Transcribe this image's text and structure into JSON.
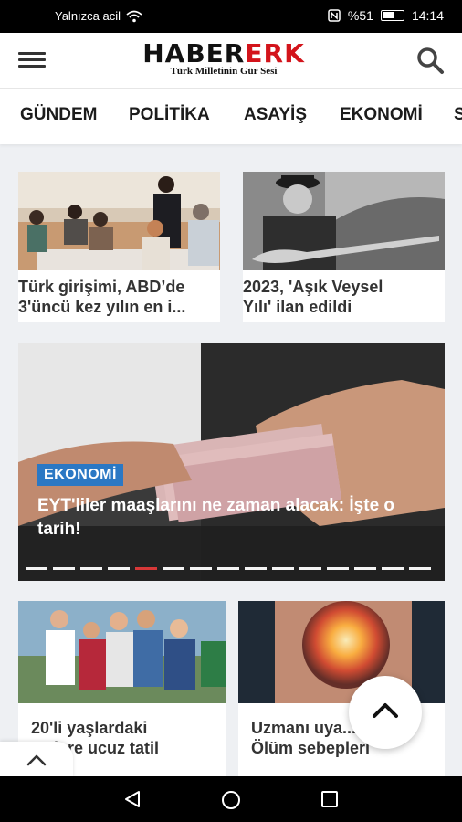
{
  "status": {
    "carrier": "Yalnızca acil",
    "battery": "%51",
    "time": "14:14"
  },
  "header": {
    "logo_part1": "HABER",
    "logo_part2": "ERK",
    "slogan": "Türk Milletinin Gür Sesi",
    "brand_colors": {
      "dark": "#111111",
      "red": "#d3141b"
    }
  },
  "categories": [
    "GÜNDEM",
    "POLİTİKA",
    "ASAYİŞ",
    "EKONOMİ",
    "S"
  ],
  "top_cards": [
    {
      "title_line1": "Türk girişimi, ABD’de",
      "title_line2": "3'üncü kez yılın en i..."
    },
    {
      "title_line1": "2023, 'Aşık Veysel",
      "title_line2": "Yılı' ilan edildi"
    }
  ],
  "hero": {
    "badge": "EKONOMİ",
    "title": "EYT'liler maaşlarını ne zaman alacak: İşte o tarih!",
    "slides_total": 16,
    "slide_active": 5
  },
  "bottom_cards": [
    {
      "title_line1": "20'li yaşlardaki",
      "title_line2": "...elere ucuz tatil"
    },
    {
      "title_line1": "Uzmanı uya...",
      "title_line2": "Ölüm sebepleri"
    }
  ],
  "icons": {
    "menu": "hamburger-icon",
    "search": "search-icon",
    "scroll_top": "chevron-up-icon",
    "back": "back-triangle-icon",
    "home": "home-circle-icon",
    "recents": "recents-square-icon"
  },
  "accent": "#2b78c4",
  "active_dot": "#e23a3a"
}
